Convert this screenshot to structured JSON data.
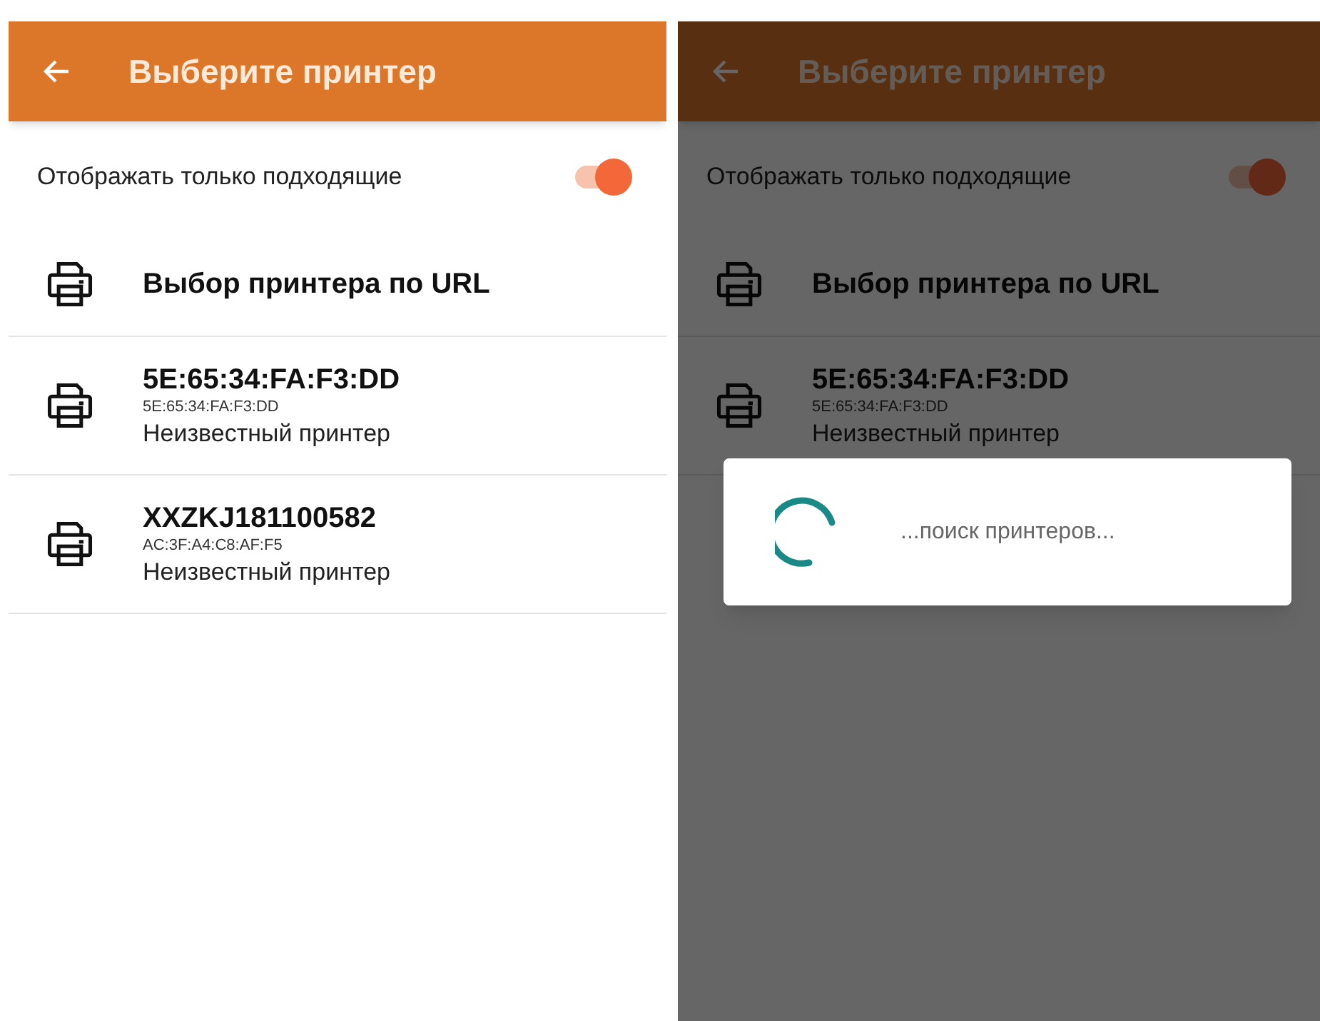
{
  "screens": [
    {
      "app_bar": {
        "title": "Выберите принтер"
      },
      "filter": {
        "label": "Отображать только подходящие",
        "on": true
      },
      "printers": [
        {
          "kind": "url",
          "name": "Выбор принтера по URL"
        },
        {
          "kind": "device",
          "name": "5E:65:34:FA:F3:DD",
          "address": "5E:65:34:FA:F3:DD",
          "description": "Неизвестный принтер"
        },
        {
          "kind": "device",
          "name": "XXZKJ181100582",
          "address": "AC:3F:A4:C8:AF:F5",
          "description": "Неизвестный принтер"
        }
      ]
    },
    {
      "app_bar": {
        "title": "Выберите принтер"
      },
      "filter": {
        "label": "Отображать только подходящие",
        "on": true
      },
      "printers": [
        {
          "kind": "url",
          "name": "Выбор принтера по URL"
        },
        {
          "kind": "device",
          "name": "5E:65:34:FA:F3:DD",
          "address": "5E:65:34:FA:F3:DD",
          "description": "Неизвестный принтер"
        }
      ],
      "dialog": {
        "message": "...поиск принтеров..."
      }
    }
  ]
}
